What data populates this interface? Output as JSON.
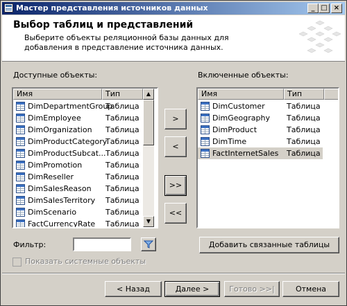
{
  "window": {
    "title": "Мастер представления источников данных",
    "controls": [
      "_",
      "□",
      "×"
    ]
  },
  "header": {
    "title": "Выбор таблиц и представлений",
    "description": "Выберите объекты реляционной базы данных для добавления в представление источника данных."
  },
  "available": {
    "label": "Доступные объекты:",
    "columns": {
      "name": "Имя",
      "type": "Тип"
    },
    "items": [
      {
        "name": "DimDepartmentGroup",
        "type": "Таблица"
      },
      {
        "name": "DimEmployee",
        "type": "Таблица"
      },
      {
        "name": "DimOrganization",
        "type": "Таблица"
      },
      {
        "name": "DimProductCategory",
        "type": "Таблица"
      },
      {
        "name": "DimProductSubcat...",
        "type": "Таблица"
      },
      {
        "name": "DimPromotion",
        "type": "Таблица"
      },
      {
        "name": "DimReseller",
        "type": "Таблица"
      },
      {
        "name": "DimSalesReason",
        "type": "Таблица"
      },
      {
        "name": "DimSalesTerritory",
        "type": "Таблица"
      },
      {
        "name": "DimScenario",
        "type": "Таблица"
      },
      {
        "name": "FactCurrencyRate",
        "type": "Таблица"
      }
    ]
  },
  "included": {
    "label": "Включенные объекты:",
    "columns": {
      "name": "Имя",
      "type": "Тип"
    },
    "items": [
      {
        "name": "DimCustomer",
        "type": "Таблица"
      },
      {
        "name": "DimGeography",
        "type": "Таблица"
      },
      {
        "name": "DimProduct",
        "type": "Таблица"
      },
      {
        "name": "DimTime",
        "type": "Таблица"
      },
      {
        "name": "FactInternetSales",
        "type": "Таблица",
        "selected": true
      }
    ]
  },
  "transfer": {
    "add": ">",
    "remove": "<",
    "add_all": ">>",
    "remove_all": "<<"
  },
  "filter": {
    "label": "Фильтр:",
    "value": "",
    "icon": "funnel-icon"
  },
  "add_related_label": "Добавить связанные таблицы",
  "show_system_label": "Показать системные объекты",
  "nav": {
    "back": "< Назад",
    "next": "Далее >",
    "finish": "Готово >>|",
    "cancel": "Отмена"
  }
}
